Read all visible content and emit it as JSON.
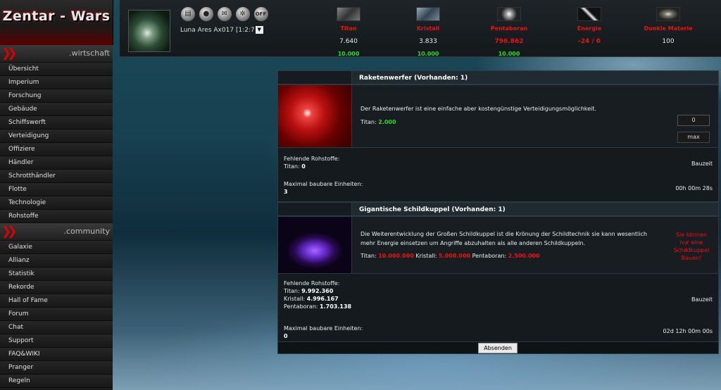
{
  "logo": "Zentar - Wars",
  "sidebar": {
    "sections": [
      {
        "label": ".wirtschaft",
        "items": [
          "Übersicht",
          "Imperium",
          "Forschung",
          "Gebäude",
          "Schiffswerft",
          "Verteidigung",
          "Offiziere",
          "Händler",
          "Schrotthändler",
          "Flotte",
          "Technologie",
          "Rohstoffe"
        ]
      },
      {
        "label": ".community",
        "items": [
          "Galaxie",
          "Allianz",
          "Statistik",
          "Rekorde",
          "Hall of Fame",
          "Forum",
          "Chat",
          "Support",
          "FAQ&WIKI",
          "Pranger",
          "Regeln"
        ]
      }
    ]
  },
  "topbar": {
    "icons": [
      "notes-icon",
      "user-icon",
      "mail-icon",
      "settings-icon",
      "logout-icon"
    ],
    "off_label": "OFF",
    "planet": "Luna Ares Ax017 [1:2:7"
  },
  "resources": [
    {
      "name": "Titan",
      "value": "7.640",
      "cap": "10.000",
      "value_red": false
    },
    {
      "name": "Kristall",
      "value": "3.833",
      "cap": "10.000",
      "value_red": false
    },
    {
      "name": "Pentaboran",
      "value": "796.862",
      "cap": "10.000",
      "value_red": true
    },
    {
      "name": "Energie",
      "value": "-24 / 0",
      "cap": "",
      "value_red": true
    },
    {
      "name": "Dunkle Materie",
      "value": "100",
      "cap": "",
      "value_red": false
    }
  ],
  "items": [
    {
      "title": "Raketenwerfer (Vorhanden: 1)",
      "description": "Der Raketenwerfer ist eine einfache aber kostengünstige Verteidigungsmöglichkeit.",
      "cost": [
        {
          "label": "Titan:",
          "value": "2.000"
        }
      ],
      "qty": "0",
      "max_label": "max",
      "missing_label": "Fehlende Rohstoffe:",
      "missing": [
        {
          "label": "Titan:",
          "value": "0"
        }
      ],
      "bauzeit_label": "Bauzeit",
      "max_units_label": "Maximal baubare Einheiten:",
      "max_units": "3",
      "time": "00h 00m 28s"
    },
    {
      "title": "Gigantische Schildkuppel (Vorhanden: 1)",
      "description": "Die Weiterentwicklung der Großen Schildkuppel ist die Krönung der Schildtechnik sie kann wesentlich mehr Energie einsetzen um Angriffe abzuhalten als alle anderen Schildkuppeln.",
      "cost": [
        {
          "label": "Titan:",
          "value": "10.000.000"
        },
        {
          "label": "Kristall:",
          "value": "5.000.000"
        },
        {
          "label": "Pentaboran:",
          "value": "2.500.000"
        }
      ],
      "cannot_build": "Sie können nur eine Schildkuppel Bauen!",
      "missing_label": "Fehlende Rohstoffe:",
      "missing": [
        {
          "label": "Titan:",
          "value": "9.992.360"
        },
        {
          "label": "Kristall:",
          "value": "4.996.167"
        },
        {
          "label": "Pentaboran:",
          "value": "1.703.138"
        }
      ],
      "bauzeit_label": "Bauzeit",
      "max_units_label": "Maximal baubare Einheiten:",
      "max_units": "0",
      "time": "02d 12h 00m 00s"
    }
  ],
  "submit_label": "Absenden",
  "colors": {
    "accent_red": "#e11111",
    "green": "#22dd22",
    "panel": "#171d21"
  }
}
